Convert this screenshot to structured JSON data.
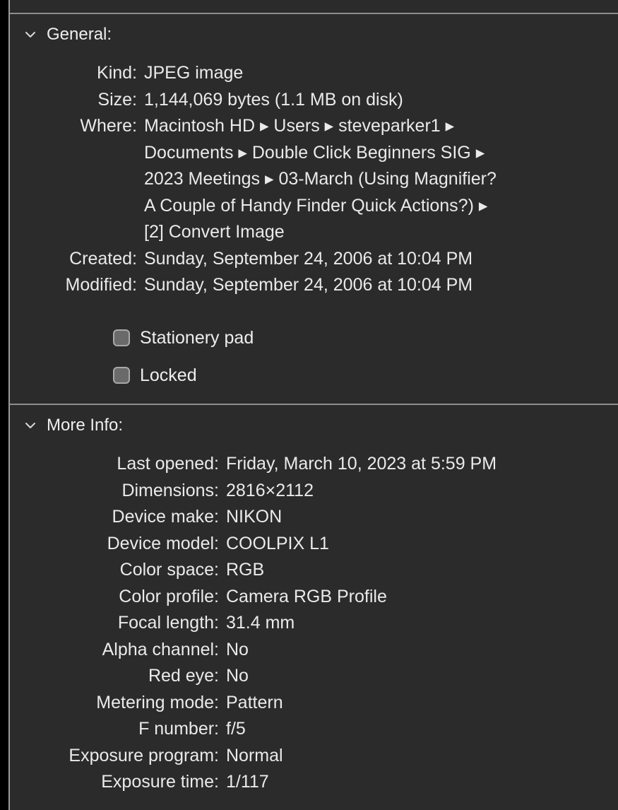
{
  "general": {
    "header": "General:",
    "rows": [
      {
        "label": "Kind:",
        "value": "JPEG image"
      },
      {
        "label": "Size:",
        "value": "1,144,069 bytes (1.1 MB on disk)"
      },
      {
        "label": "Where:",
        "value_lines": [
          "Macintosh HD ▸ Users ▸ steveparker1 ▸",
          "Documents ▸ Double Click Beginners SIG ▸",
          "2023 Meetings ▸ 03-March (Using Magnifier?",
          "A Couple of Handy Finder Quick Actions?) ▸",
          "[2] Convert Image"
        ]
      },
      {
        "label": "Created:",
        "value": "Sunday, September 24, 2006 at 10:04 PM"
      },
      {
        "label": "Modified:",
        "value": "Sunday, September 24, 2006 at 10:04 PM"
      }
    ],
    "checkboxes": [
      {
        "label": "Stationery pad",
        "checked": false
      },
      {
        "label": "Locked",
        "checked": false
      }
    ]
  },
  "more_info": {
    "header": "More Info:",
    "rows": [
      {
        "label": "Last opened:",
        "value": "Friday, March 10, 2023 at 5:59 PM"
      },
      {
        "label": "Dimensions:",
        "value": "2816×2112"
      },
      {
        "label": "Device make:",
        "value": "NIKON"
      },
      {
        "label": "Device model:",
        "value": "COOLPIX L1"
      },
      {
        "label": "Color space:",
        "value": "RGB"
      },
      {
        "label": "Color profile:",
        "value": "Camera RGB Profile"
      },
      {
        "label": "Focal length:",
        "value": "31.4 mm"
      },
      {
        "label": "Alpha channel:",
        "value": "No"
      },
      {
        "label": "Red eye:",
        "value": "No"
      },
      {
        "label": "Metering mode:",
        "value": "Pattern"
      },
      {
        "label": "F number:",
        "value": "f/5"
      },
      {
        "label": "Exposure program:",
        "value": "Normal"
      },
      {
        "label": "Exposure time:",
        "value": "1/117"
      }
    ]
  },
  "icons": {
    "disclosure": "chevron-down-icon"
  },
  "colors": {
    "panel_bg": "#2b2b2b",
    "text": "#eaeaea",
    "divider": "#8e8e8e",
    "checkbox_fill": "#6a6a6a"
  }
}
